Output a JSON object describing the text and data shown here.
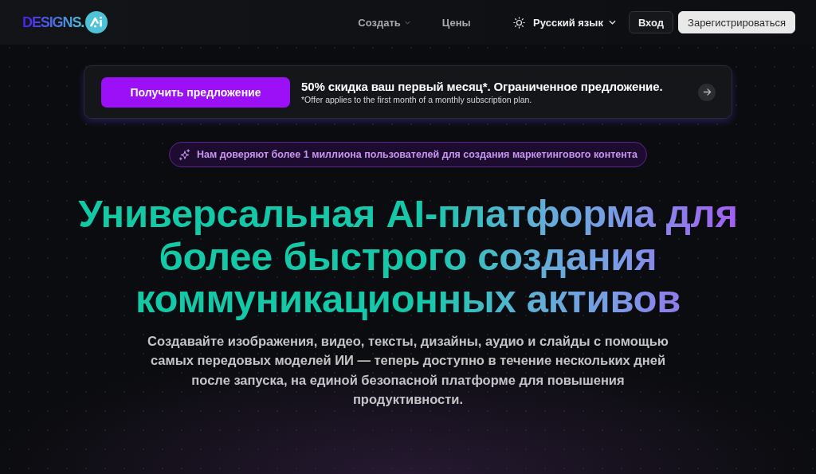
{
  "header": {
    "logo": {
      "text": "DESIGNS."
    },
    "nav": [
      {
        "label": "Создать",
        "has_dropdown": true
      },
      {
        "label": "Цены",
        "has_dropdown": false
      }
    ],
    "language": {
      "label": "Русский язык"
    },
    "buttons": [
      {
        "label": "Вход",
        "kind": "outline"
      },
      {
        "label": "Зарегистрироваться",
        "kind": "filled"
      }
    ]
  },
  "promo": {
    "button": "Получить предложение",
    "headline": "50% скидка ваш первый месяц*. Ограниченное предложение.",
    "note": "*Offer applies to the first month of a monthly subscription plan."
  },
  "badge": {
    "text": "Нам доверяют более 1 миллиона пользователей для создания маркетингового контента"
  },
  "hero": {
    "title_lines": [
      "Универсальная AI-платформа для",
      "более быстрого создания",
      "коммуникационных активов"
    ],
    "description": "Создавайте изображения, видео, тексты, дизайны, аудио и слайды с помощью самых передовых моделей ИИ — теперь доступно в течение нескольких дней после запуска, на единой безопасной платформе для повышения продуктивности."
  }
}
